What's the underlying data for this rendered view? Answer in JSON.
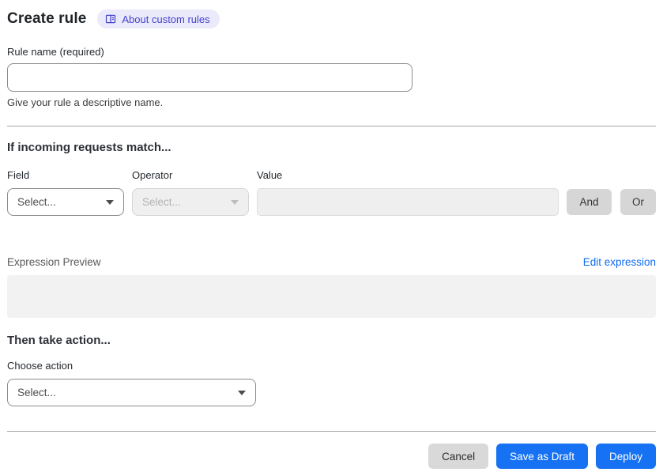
{
  "header": {
    "title": "Create rule",
    "badge_label": "About custom rules"
  },
  "rule_name": {
    "label": "Rule name (required)",
    "value": "",
    "helper": "Give your rule a descriptive name."
  },
  "match_section": {
    "heading": "If incoming requests match...",
    "field": {
      "label": "Field",
      "selected": "Select..."
    },
    "operator": {
      "label": "Operator",
      "selected": "Select..."
    },
    "value": {
      "label": "Value",
      "value": ""
    },
    "and_label": "And",
    "or_label": "Or"
  },
  "expression": {
    "label": "Expression Preview",
    "edit_link": "Edit expression",
    "content": ""
  },
  "action_section": {
    "heading": "Then take action...",
    "choose_label": "Choose action",
    "selected": "Select..."
  },
  "footer": {
    "cancel": "Cancel",
    "save_draft": "Save as Draft",
    "deploy": "Deploy"
  },
  "colors": {
    "primary_blue": "#1672f3",
    "link_blue": "#0f6cf0",
    "badge_bg": "#ebeafa",
    "badge_text": "#4343cf",
    "disabled_bg": "#efefef",
    "divider": "#a6a6a6"
  }
}
